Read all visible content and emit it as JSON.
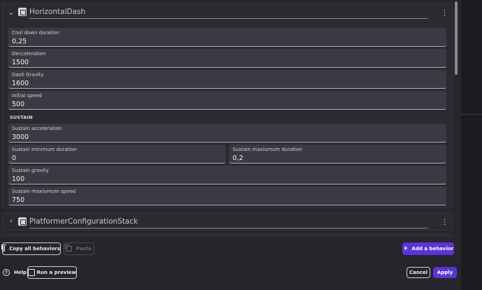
{
  "behaviors": [
    {
      "name": "HorizontalDash",
      "fields": {
        "cooldown": {
          "label": "Cool down duration",
          "value": "0,25"
        },
        "deceleration": {
          "label": "Decceleration",
          "value": "1500"
        },
        "dash_gravity": {
          "label": "Dash Gravity",
          "value": "1600"
        },
        "initial_speed": {
          "label": "Initial speed",
          "value": "500"
        }
      },
      "section": "SUSTAIN",
      "sustain_fields": {
        "acceleration": {
          "label": "Sustain acceleration",
          "value": "3000"
        },
        "min_duration": {
          "label": "Sustain minimum duration",
          "value": "0"
        },
        "max_duration": {
          "label": "Sustain maxiumum duration",
          "value": "0,2"
        },
        "gravity": {
          "label": "Sustain gravity",
          "value": "100"
        },
        "max_speed": {
          "label": "Sustain maxiumum speed",
          "value": "750"
        }
      }
    },
    {
      "name": "PlatformerConfigurationStack"
    }
  ],
  "footer": {
    "copy_all": "Copy all behaviors",
    "paste": "Paste",
    "add_behavior": "Add a behavior",
    "help": "Help",
    "run_preview": "Run a preview",
    "cancel": "Cancel",
    "apply": "Apply"
  },
  "colors": {
    "accent": "#5a34d6",
    "panel": "#2a2a31",
    "field": "#3a3a42"
  },
  "icons": {
    "expand": "chevron-down-icon",
    "collapse": "chevron-right-icon",
    "behavior": "behavior-icon",
    "menu": "kebab-menu-icon"
  }
}
